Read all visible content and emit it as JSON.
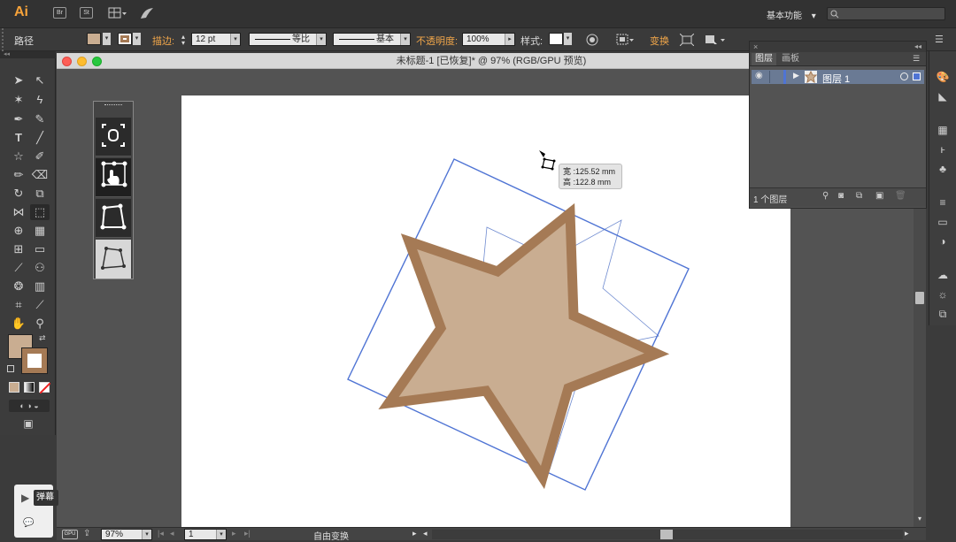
{
  "app": {
    "logo": "Ai",
    "bridge_label": "Br",
    "stock_label": "St",
    "workspace": "基本功能",
    "workspace_arrow": "▾",
    "search_placeholder": ""
  },
  "control_bar": {
    "selection_type": "路径",
    "stroke_label": "描边:",
    "stroke_weight": "12 pt",
    "profile_label": "等比",
    "brush_label": "基本",
    "opacity_label": "不透明度:",
    "opacity_value": "100%",
    "style_label": "样式:",
    "transform_label": "变换",
    "fill_color": "#c9ad91",
    "stroke_color": "#a57a55"
  },
  "document": {
    "title": "未标题-1 [已恢复]* @ 97% (RGB/GPU 预览)"
  },
  "tooltip": {
    "width_text": "宽 :125.52 mm",
    "height_text": "高 :122.8 mm"
  },
  "layers_panel": {
    "tab_layers": "图层",
    "tab_artboards": "画板",
    "layer_name": "图层 1",
    "layer_count": "1 个图层"
  },
  "status_bar": {
    "zoom": "97%",
    "page": "1",
    "tool_name": "自由变换"
  },
  "overlay": {
    "label": "弹幕"
  },
  "colors": {
    "star_fill": "#c9ad91",
    "star_stroke": "#a57a55",
    "selection_blue": "#4f74d4",
    "accent_orange": "#f0a64a"
  }
}
